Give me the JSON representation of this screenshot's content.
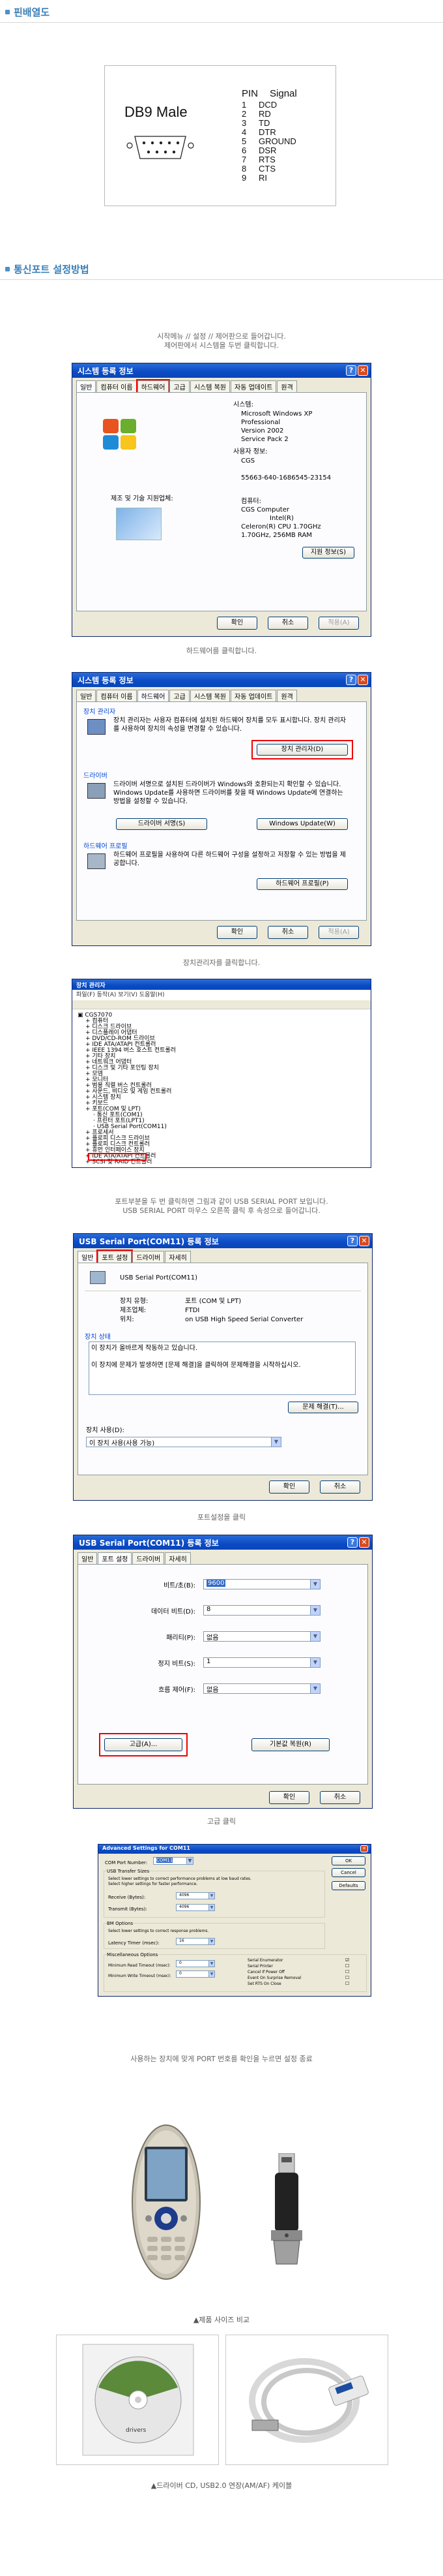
{
  "sections": {
    "pin_title": "핀배열도",
    "setup_title": "통신포트 설정방법"
  },
  "db9": {
    "title": "DB9 Male",
    "pin_header": "PIN",
    "signal_header": "Signal",
    "pins": [
      {
        "num": "1",
        "sig": "DCD"
      },
      {
        "num": "2",
        "sig": "RD"
      },
      {
        "num": "3",
        "sig": "TD"
      },
      {
        "num": "4",
        "sig": "DTR"
      },
      {
        "num": "5",
        "sig": "GROUND"
      },
      {
        "num": "6",
        "sig": "DSR"
      },
      {
        "num": "7",
        "sig": "RTS"
      },
      {
        "num": "8",
        "sig": "CTS"
      },
      {
        "num": "9",
        "sig": "RI"
      }
    ]
  },
  "intro": {
    "line1": "시작메뉴 // 설정 // 제어판으로 들어갑니다.",
    "line2": "제어판에서 시스템을 두번 클릭합니다."
  },
  "dialog1": {
    "title": "시스템 등록 정보",
    "tabs": [
      "일반",
      "컴퓨터 이름",
      "하드웨어",
      "고급",
      "시스템 복원",
      "자동 업데이트",
      "원격"
    ],
    "system_label": "시스템:",
    "system_lines": [
      "Microsoft Windows XP",
      "Professional",
      "Version 2002",
      "Service Pack 2"
    ],
    "user_label": "사용자 정보:",
    "user_lines": [
      "CGS",
      "",
      "55663-640-1686545-23154"
    ],
    "maker_label": "제조 및 기술 지원업체:",
    "computer_lines": [
      "컴퓨터:",
      "CGS Computer",
      "Intel(R)",
      "Celeron(R) CPU 1.70GHz",
      "1.70GHz, 256MB RAM"
    ],
    "support_button": "지원 정보(S)",
    "ok": "확인",
    "cancel": "취소",
    "apply": "적용(A)",
    "caption": "하드웨어를 클릭합니다."
  },
  "dialog2": {
    "title": "시스템 등록 정보",
    "tabs": [
      "일반",
      "컴퓨터 이름",
      "하드웨어",
      "고급",
      "시스템 복원",
      "자동 업데이트",
      "원격"
    ],
    "devmgr_group": "장치 관리자",
    "devmgr_text": "장치 관리자는 사용자 컴퓨터에 설치된 하드웨어 장치를 모두 표시합니다. 장치 관리자를 사용하여 장치의 속성을 변경할 수 있습니다.",
    "devmgr_button": "장치 관리자(D)",
    "driver_group": "드라이버",
    "driver_text": "드라이버 서명으로 설치된 드라이버가 Windows와 호환되는지 확인할 수 있습니다. Windows Update를 사용하면 드라이버를 찾을 때 Windows Update에 연결하는 방법을 설정할 수 있습니다.",
    "driver_sign_button": "드라이버 서명(S)",
    "windows_update_button": "Windows Update(W)",
    "profile_group": "하드웨어 프로필",
    "profile_text": "하드웨어 프로필을 사용하여 다른 하드웨어 구성을 설정하고 저장할 수 있는 방법을 제공합니다.",
    "profile_button": "하드웨어 프로필(P)",
    "ok": "확인",
    "cancel": "취소",
    "apply": "적용(A)",
    "caption": "장치관리자를 클릭합니다."
  },
  "devmgr": {
    "title": "장치 관리자",
    "menu": "파일(F)  동작(A)  보기(V)  도움말(H)",
    "tree": [
      "CGS7070",
      "컴퓨터",
      "디스크 드라이브",
      "디스플레이 어댑터",
      "DVD/CD-ROM 드라이브",
      "IDE ATA/ATAPI 컨트롤러",
      "IEEE 1394 버스 호스트 컨트롤러",
      "기타 장치",
      "네트워크 어댑터",
      "디스크 및 기타 포인팅 장치",
      "모뎀",
      "모니터",
      "범용 직렬 버스 컨트롤러",
      "사운드, 비디오 및 게임 컨트롤러",
      "시스템 장치",
      "키보드",
      "포트(COM 및 LPT)",
      "통신 포트(COM1)",
      "프린터 포트(LPT1)",
      "USB Serial Port(COM11)",
      "프로세서",
      "플로피 디스크 드라이브",
      "플로피 디스크 컨트롤러",
      "휴먼 인터페이스 장치",
      "IDE ATA/ATAPI 컨트롤러",
      "SCSI 및 RAID 컨트롤러"
    ],
    "caption1": "포트부분을 두 번 클릭하면 그림과 같이 USB SERIAL PORT 보입니다.",
    "caption2": "USB SERIAL PORT 마우스 오른쪽 클릭 후 속성으로 들어갑니다."
  },
  "dialog3": {
    "title": "USB Serial Port(COM11) 등록 정보",
    "tabs": [
      "일반",
      "포트 설정",
      "드라이버",
      "자세히"
    ],
    "device_name": "USB Serial Port(COM11)",
    "type_label": "장치 유형:",
    "type_value": "포트 (COM 및 LPT)",
    "maker_label": "제조업체:",
    "maker_value": "FTDI",
    "loc_label": "위치:",
    "loc_value": "on USB High Speed Serial Converter",
    "status_group": "장치 상태",
    "status_text": "이 장치가 올바르게 작동하고 있습니다.\n\n이 장치에 문제가 발생하면 [문제 해결]을 클릭하여 문제해결을 시작하십시오.",
    "trouble_button": "문제 해결(T)...",
    "usage_label": "장치 사용(D):",
    "usage_value": "이 장치 사용(사용 가능)",
    "ok": "확인",
    "cancel": "취소",
    "caption": "포트설정을 클릭"
  },
  "dialog4": {
    "title": "USB Serial Port(COM11) 등록 정보",
    "tabs": [
      "일반",
      "포트 설정",
      "드라이버",
      "자세히"
    ],
    "fields": [
      {
        "label": "비트/초(B):",
        "value": "9600"
      },
      {
        "label": "데이터 비트(D):",
        "value": "8"
      },
      {
        "label": "패리티(P):",
        "value": "없음"
      },
      {
        "label": "정지 비트(S):",
        "value": "1"
      },
      {
        "label": "흐름 제어(F):",
        "value": "없음"
      }
    ],
    "advanced_button": "고급(A)...",
    "restore_button": "기본값 복원(R)",
    "ok": "확인",
    "cancel": "취소",
    "caption": "고급 클릭"
  },
  "adv": {
    "title": "Advanced Settings for COM11",
    "port_label": "COM Port Number:",
    "port_value": "COM11",
    "ok": "OK",
    "cancel": "Cancel",
    "defaults": "Defaults",
    "usb_group": "USB Transfer Sizes",
    "usb_note1": "Select lower settings to correct performance problems at low baud rates.",
    "usb_note2": "Select higher settings for faster performance.",
    "receive_label": "Receive (Bytes):",
    "receive_value": "4096",
    "transmit_label": "Transmit (Bytes):",
    "transmit_value": "4096",
    "bm_group": "BM Options",
    "bm_note": "Select lower settings to correct response problems.",
    "latency_label": "Latency Timer (msec):",
    "latency_value": "16",
    "misc_group": "Miscellaneous Options",
    "min_read_label": "Minimum Read Timeout (msec):",
    "min_read_value": "0",
    "min_write_label": "Minimum Write Timeout (msec):",
    "min_write_value": "0",
    "options": [
      "Serial Enumerator",
      "Serial Printer",
      "Cancel If Power Off",
      "Event On Surprise Removal",
      "Set RTS On Close"
    ],
    "caption": "사용하는 장치에 맞게 PORT 번호를 확인을 누르면 설정 종료"
  },
  "photos": {
    "caption1": "▲제품 사이즈 비교",
    "caption2": "▲드라이버 CD, USB2.0 연장(AM/AF) 케이블",
    "cd_label": "drivers"
  }
}
